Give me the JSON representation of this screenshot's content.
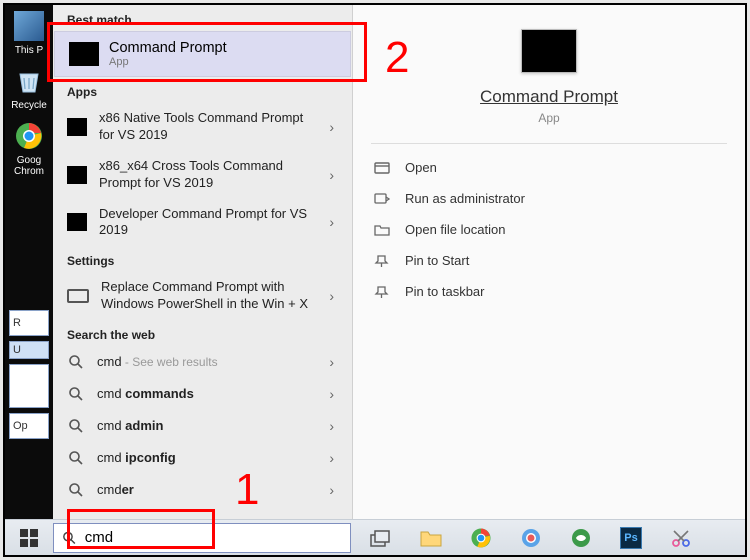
{
  "annotations": {
    "num1": "1",
    "num2": "2"
  },
  "desktop": {
    "thispc": "This P",
    "recycle": "Recycle",
    "chrome": "Goog\nChrom"
  },
  "cards": {
    "r": "R",
    "u": "U",
    "op": "Op"
  },
  "start": {
    "best_match_hdr": "Best match",
    "best_match": {
      "title": "Command Prompt",
      "sub": "App"
    },
    "apps_hdr": "Apps",
    "apps": [
      {
        "label": "x86 Native Tools Command Prompt for VS 2019"
      },
      {
        "label": "x86_x64 Cross Tools Command Prompt for VS 2019"
      },
      {
        "label": "Developer Command Prompt for VS 2019"
      }
    ],
    "settings_hdr": "Settings",
    "settings": [
      {
        "label": "Replace Command Prompt with Windows PowerShell in the Win + X"
      }
    ],
    "web_hdr": "Search the web",
    "web": [
      {
        "label": "cmd",
        "hint": " - See web results"
      },
      {
        "label_html": "cmd <b>commands</b>"
      },
      {
        "label_html": "cmd <b>admin</b>"
      },
      {
        "label_html": "cmd <b>ipconfig</b>"
      },
      {
        "label_html": "cmd<b>er</b>"
      }
    ]
  },
  "preview": {
    "title": "Command Prompt",
    "sub": "App",
    "actions": {
      "open": "Open",
      "admin": "Run as administrator",
      "loc": "Open file location",
      "pin_start": "Pin to Start",
      "pin_task": "Pin to taskbar"
    }
  },
  "search": {
    "value": "cmd"
  }
}
